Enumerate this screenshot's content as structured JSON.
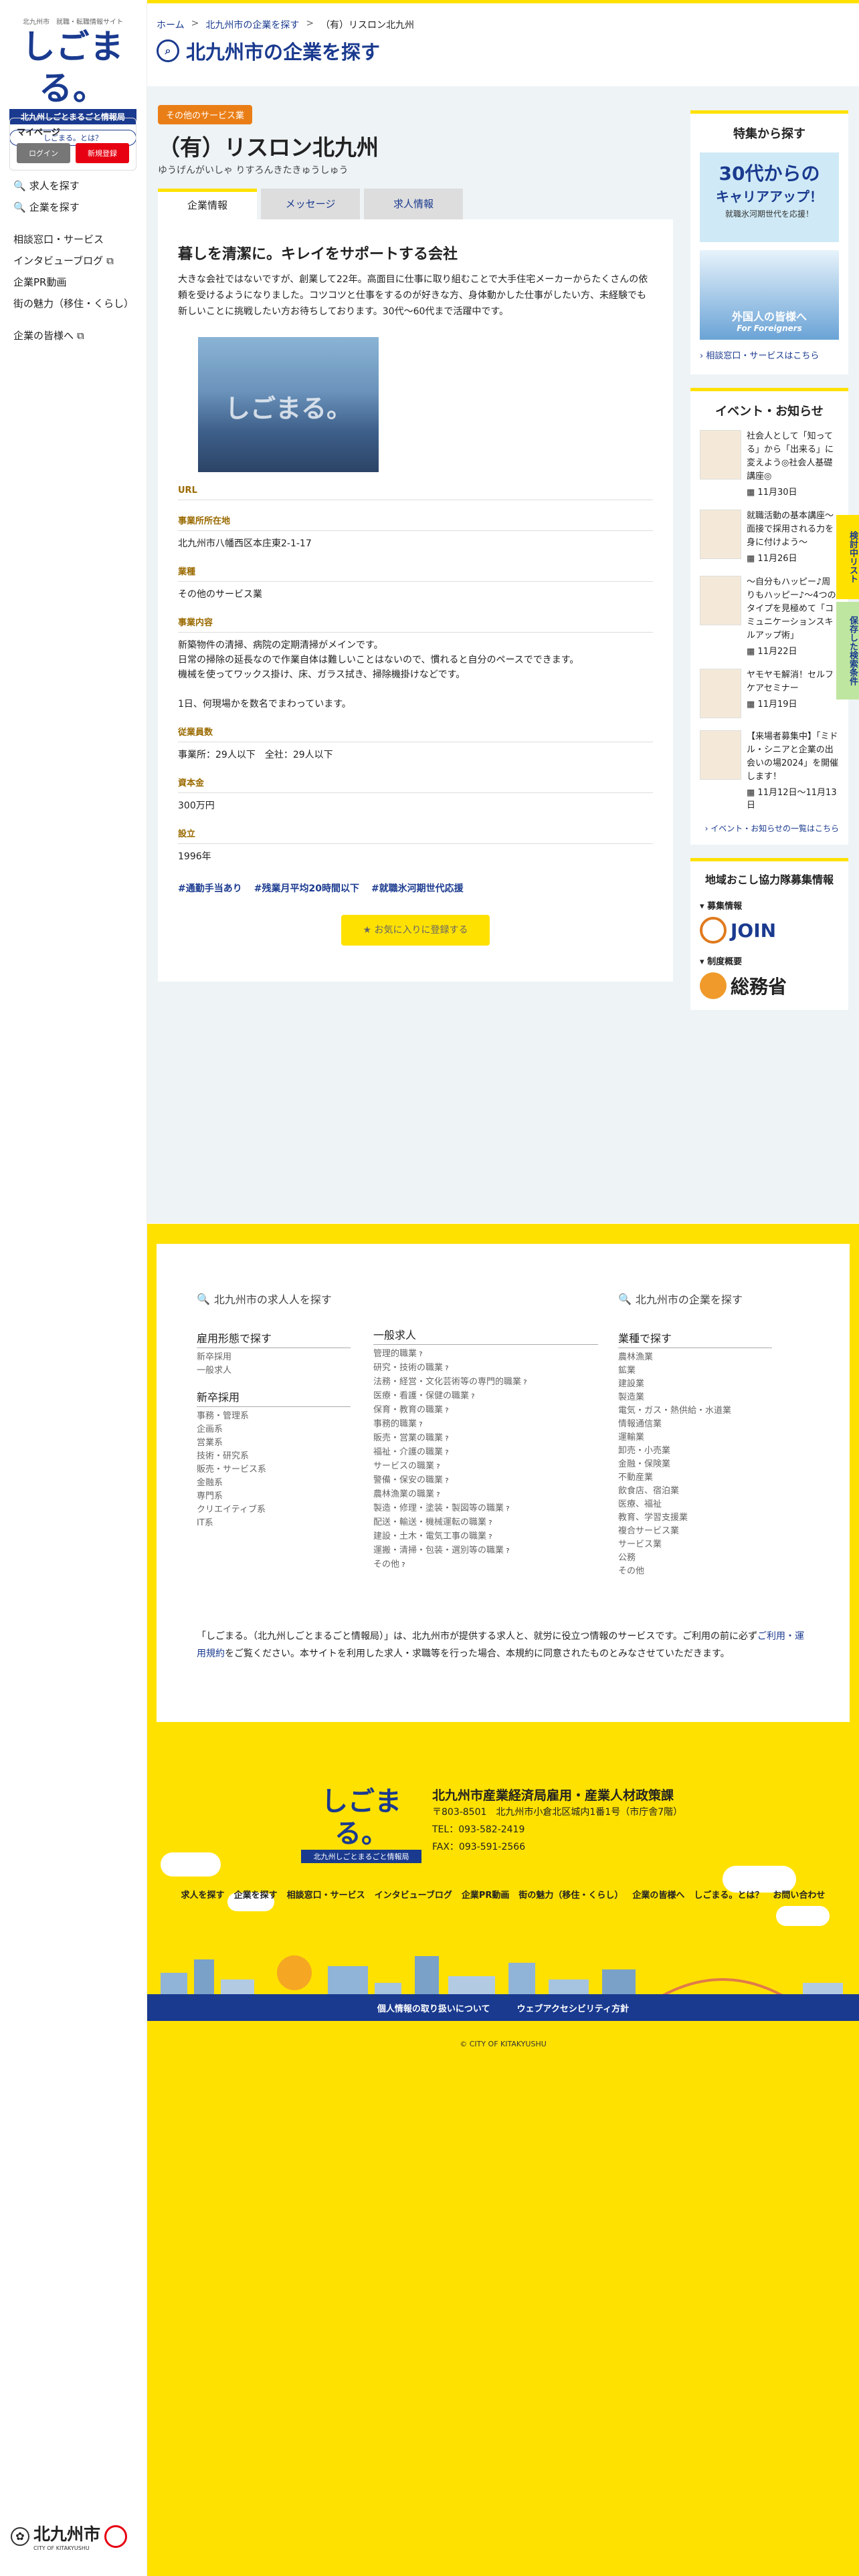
{
  "sidebar": {
    "logo_sub": "北九州市　就職・転職情報サイト",
    "logo_main": "しごまる。",
    "logo_tag": "北九州しごとまるごと情報局",
    "whats": "しごまる。とは？",
    "mypage_title": "マイページ",
    "login": "ログイン",
    "register": "新規登録",
    "nav": [
      "求人を探す",
      "企業を探す",
      "相談窓口・サービス",
      "インタビューブログ",
      "企業PR動画",
      "街の魅力（移住・くらし）",
      "企業の皆様へ"
    ],
    "city_name": "北九州市",
    "city_sub": "CITY OF KITAKYUSHU"
  },
  "breadcrumb": [
    "ホーム",
    ">",
    "北九州市の企業を探す",
    ">",
    "（有）リスロン北九州"
  ],
  "page_title": "北九州市の企業を探す",
  "company": {
    "category": "その他のサービス業",
    "name": "（有）リスロン北九州",
    "kana": "ゆうげんがいしゃ りすろんきたきゅうしゅう",
    "tabs": [
      "企業情報",
      "メッセージ",
      "求人情報"
    ],
    "headline": "暮しを清潔に。キレイをサポートする会社",
    "lead": "大きな会社ではないですが、創業して22年。高面目に仕事に取り組むことで大手住宅メーカーからたくさんの依頼を受けるようになりました。コツコツと仕事をするのが好きな方、身体動かした仕事がしたい方、未経験でも新しいことに挑戦したい方お待ちしております。30代〜60代まで活躍中です。",
    "photo_watermark": "しごまる。",
    "fields": [
      {
        "label": "URL",
        "value": ""
      },
      {
        "label": "事業所所在地",
        "value": "北九州市八幡西区本庄東2-1-17"
      },
      {
        "label": "業種",
        "value": "その他のサービス業"
      },
      {
        "label": "事業内容",
        "value": "新築物件の清掃、病院の定期清掃がメインです。\n日常の掃除の延長なので作業自体は難しいことはないので、慣れると自分のペースでできます。\n機械を使ってワックス掛け、床、ガラス拭き、掃除機掛けなどです。\n\n1日、何現場かを数名でまわっています。"
      },
      {
        "label": "従業員数",
        "value": "事業所：29人以下　全社：29人以下"
      },
      {
        "label": "資本金",
        "value": "300万円"
      },
      {
        "label": "設立",
        "value": "1996年"
      }
    ],
    "tags": [
      "#通勤手当あり",
      "#残業月平均20時間以下",
      "#就職氷河期世代応援"
    ],
    "fav_button": "お気に入りに登録する"
  },
  "right": {
    "feature_title": "特集から探す",
    "banner1_big": "30代からの",
    "banner1_big2": "キャリアアップ！",
    "banner1_small": "就職氷河期世代を応援！",
    "banner2_text": "外国人の皆様へ",
    "banner2_sub": "For Foreigners",
    "feature_link": "相談窓口・サービスはこちら",
    "event_title": "イベント・お知らせ",
    "events": [
      {
        "title": "社会人として「知ってる」から「出来る」に変えよう◎社会人基礎講座◎",
        "date": "11月30日"
      },
      {
        "title": "就職活動の基本講座〜面接で採用される力を身に付けよう〜",
        "date": "11月26日"
      },
      {
        "title": "〜自分もハッピー♪周りもハッピー♪〜4つのタイプを見極めて「コミュニケーションスキルアップ術」",
        "date": "11月22日"
      },
      {
        "title": "ヤモヤモ解消！セルフケアセミナー",
        "date": "11月19日"
      },
      {
        "title": "【来場者募集中】「ミドル・シニアと企業の出会いの場2024」を開催します！",
        "date": "11月12日〜11月13日"
      }
    ],
    "event_more": "イベント・お知らせの一覧はこちら",
    "local_title": "地域おこし協力隊募集情報",
    "local_sub1": "募集情報",
    "join_text": "JOIN",
    "local_sub2": "制度概要",
    "soumu_text": "総務省"
  },
  "side_tabs": [
    "検討中リスト",
    "保存した検索条件"
  ],
  "footer": {
    "jobs_head": "北九州市の求人人を探す",
    "company_head": "北九州市の企業を探す",
    "col1_groups": [
      {
        "head": "雇用形態で探す",
        "items": [
          "新卒採用",
          "一般求人"
        ]
      },
      {
        "head": "新卒採用",
        "items": [
          "事務・管理系",
          "企画系",
          "営業系",
          "技術・研究系",
          "販売・サービス系",
          "金融系",
          "専門系",
          "クリエイティブ系",
          "IT系"
        ]
      }
    ],
    "col2_head": "一般求人",
    "col2_items": [
      "管理的職業",
      "研究・技術の職業",
      "法務・経営・文化芸術等の専門的職業",
      "医療・看護・保健の職業",
      "保育・教育の職業",
      "事務的職業",
      "販売・営業の職業",
      "福祉・介護の職業",
      "サービスの職業",
      "警備・保安の職業",
      "農林漁業の職業",
      "製造・修理・塗装・製図等の職業",
      "配送・輸送・機械運転の職業",
      "建設・土木・電気工事の職業",
      "運搬・清掃・包装・選別等の職業",
      "その他"
    ],
    "col3_head": "業種で探す",
    "col3_items": [
      "農林漁業",
      "鉱業",
      "建設業",
      "製造業",
      "電気・ガス・熱供給・水道業",
      "情報通信業",
      "運輸業",
      "卸売・小売業",
      "金融・保険業",
      "不動産業",
      "飲食店、宿泊業",
      "医療、福祉",
      "教育、学習支援業",
      "複合サービス業",
      "サービス業",
      "公務",
      "その他"
    ],
    "notice_1": "「しごまる。（北九州しごとまるごと情報局）」は、北九州市が提供する求人と、就労に役立つ情報のサービスです。ご利用の前に必ず",
    "notice_link": "ご利用・運用規約",
    "notice_2": "をご覧ください。本サイトを利用した求人・求職等を行った場合、本規約に同意されたものとみなさせていただきます。",
    "logo_main": "しごまる。",
    "logo_tag": "北九州しごとまるごと情報局",
    "org": "北九州市産業経済局雇用・産業人材政策課",
    "addr": "〒803-8501　北九州市小倉北区城内1番1号（市庁舎7階）",
    "tel": "TEL：093-582-2419",
    "fax": "FAX：093-591-2566",
    "nav": [
      "求人を探す",
      "企業を探す",
      "相談窓口・サービス",
      "インタビューブログ",
      "企業PR動画",
      "街の魅力（移住・くらし）",
      "企業の皆様へ",
      "しごまる。とは？",
      "お問い合わせ"
    ],
    "bar_links": [
      "個人情報の取り扱いについて",
      "ウェブアクセシビリティ方針"
    ],
    "copyright": "© CITY OF KITAKYUSHU"
  },
  "colors": {
    "brand": "#1a3a8f",
    "accent": "#ffe100",
    "badge": "#ea7e16"
  }
}
